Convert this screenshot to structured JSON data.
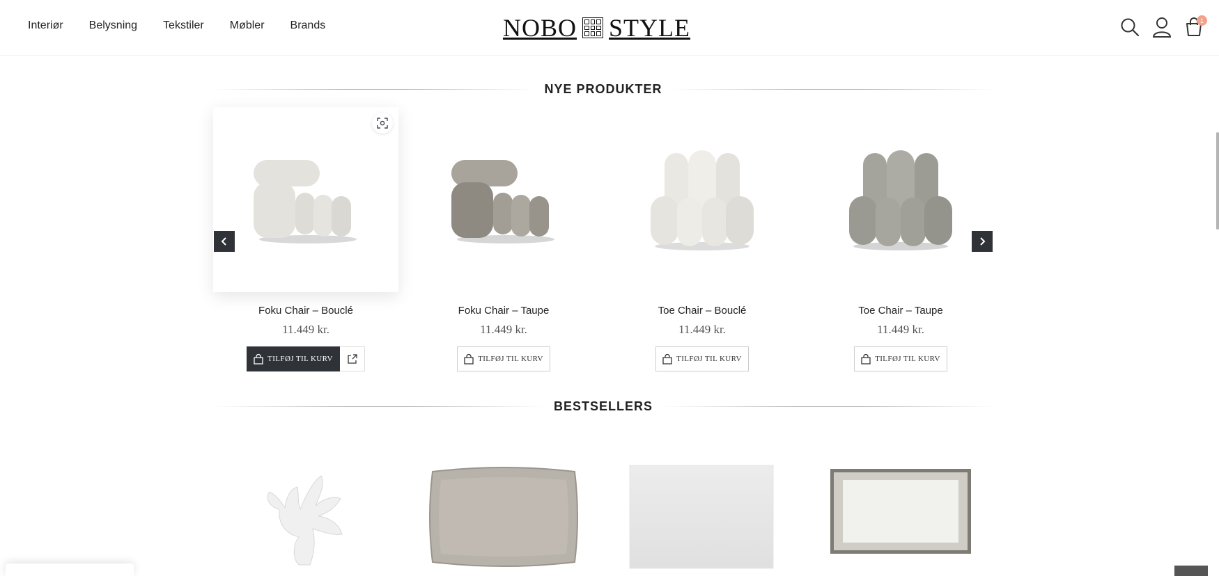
{
  "nav": [
    "Interiør",
    "Belysning",
    "Tekstiler",
    "Møbler",
    "Brands"
  ],
  "logo": {
    "left": "NOBO",
    "right": "STYLE"
  },
  "header_icons": [
    "search-icon",
    "user-icon",
    "cart-icon"
  ],
  "cart_count": "1",
  "new_products": {
    "title": "NYE PRODUKTER",
    "items": [
      {
        "name": "Foku Chair – Bouclé",
        "price": "11.449 kr.",
        "button": "TILFØJ TIL KURV",
        "color": "#e4e2dd"
      },
      {
        "name": "Foku Chair – Taupe",
        "price": "11.449 kr.",
        "button": "TILFØJ TIL KURV",
        "color": "#9d9890"
      },
      {
        "name": "Toe Chair – Bouclé",
        "price": "11.449 kr.",
        "button": "TILFØJ TIL KURV",
        "color": "#ebe9e3"
      },
      {
        "name": "Toe Chair – Taupe",
        "price": "11.449 kr.",
        "button": "TILFØJ TIL KURV",
        "color": "#9e9d96"
      }
    ]
  },
  "bestsellers": {
    "title": "BESTSELLERS",
    "items": [
      "coral-figurine",
      "linen-cushion",
      "white-rug",
      "mirror-tray"
    ]
  },
  "colors": {
    "dark": "#2f3237",
    "badge": "#f2a28b"
  }
}
